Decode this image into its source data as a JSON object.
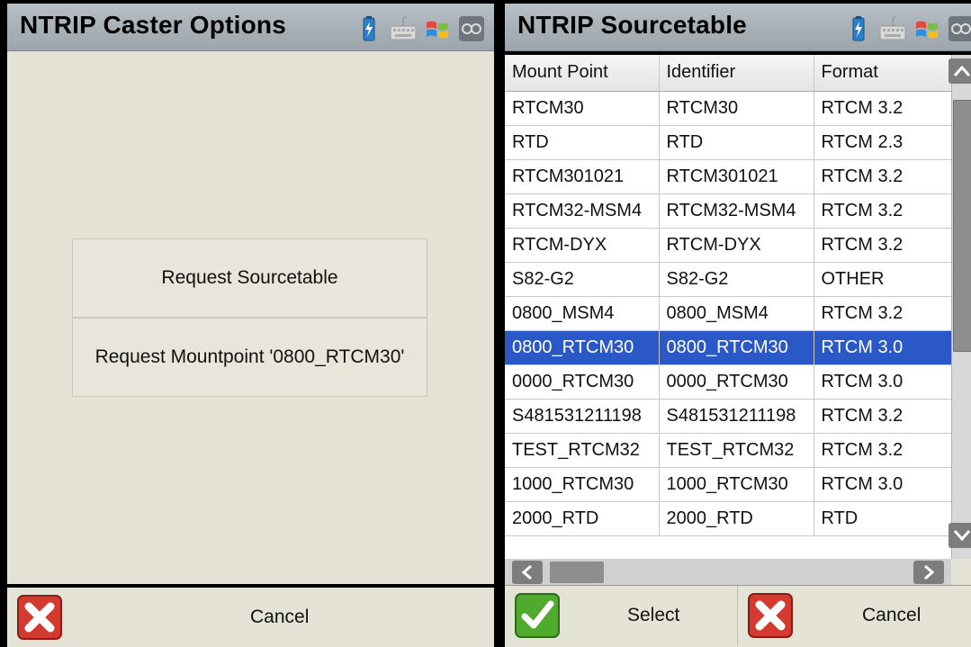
{
  "left": {
    "title": "NTRIP Caster Options",
    "buttons": {
      "request_sourcetable": "Request Sourcetable",
      "request_mountpoint": "Request Mountpoint '0800_RTCM30'"
    },
    "cancel_label": "Cancel"
  },
  "right": {
    "title": "NTRIP Sourcetable",
    "columns": [
      "Mount Point",
      "Identifier",
      "Format"
    ],
    "rows": [
      [
        "RTCM30",
        "RTCM30",
        "RTCM 3.2"
      ],
      [
        "RTD",
        "RTD",
        "RTCM 2.3"
      ],
      [
        "RTCM301021",
        "RTCM301021",
        "RTCM 3.2"
      ],
      [
        "RTCM32-MSM4",
        "RTCM32-MSM4",
        "RTCM 3.2"
      ],
      [
        "RTCM-DYX",
        "RTCM-DYX",
        "RTCM 3.2"
      ],
      [
        "S82-G2",
        "S82-G2",
        "OTHER"
      ],
      [
        "0800_MSM4",
        "0800_MSM4",
        "RTCM 3.2"
      ],
      [
        "0800_RTCM30",
        "0800_RTCM30",
        "RTCM 3.0"
      ],
      [
        "0000_RTCM30",
        "0000_RTCM30",
        "RTCM 3.0"
      ],
      [
        "S481531211198",
        "S481531211198",
        "RTCM 3.2"
      ],
      [
        "TEST_RTCM32",
        "TEST_RTCM32",
        "RTCM 3.2"
      ],
      [
        "1000_RTCM30",
        "1000_RTCM30",
        "RTCM 3.0"
      ],
      [
        "2000_RTD",
        "2000_RTD",
        "RTD"
      ]
    ],
    "selected_row_index": 7,
    "select_label": "Select",
    "cancel_label": "Cancel"
  },
  "tray_icons": [
    "battery-icon",
    "keyboard-icon",
    "windows-flag-icon",
    "ok-square-icon"
  ],
  "colors": {
    "title_bar": "#a9b1b8",
    "background": "#e4e3d6",
    "selection": "#2a58c7"
  }
}
